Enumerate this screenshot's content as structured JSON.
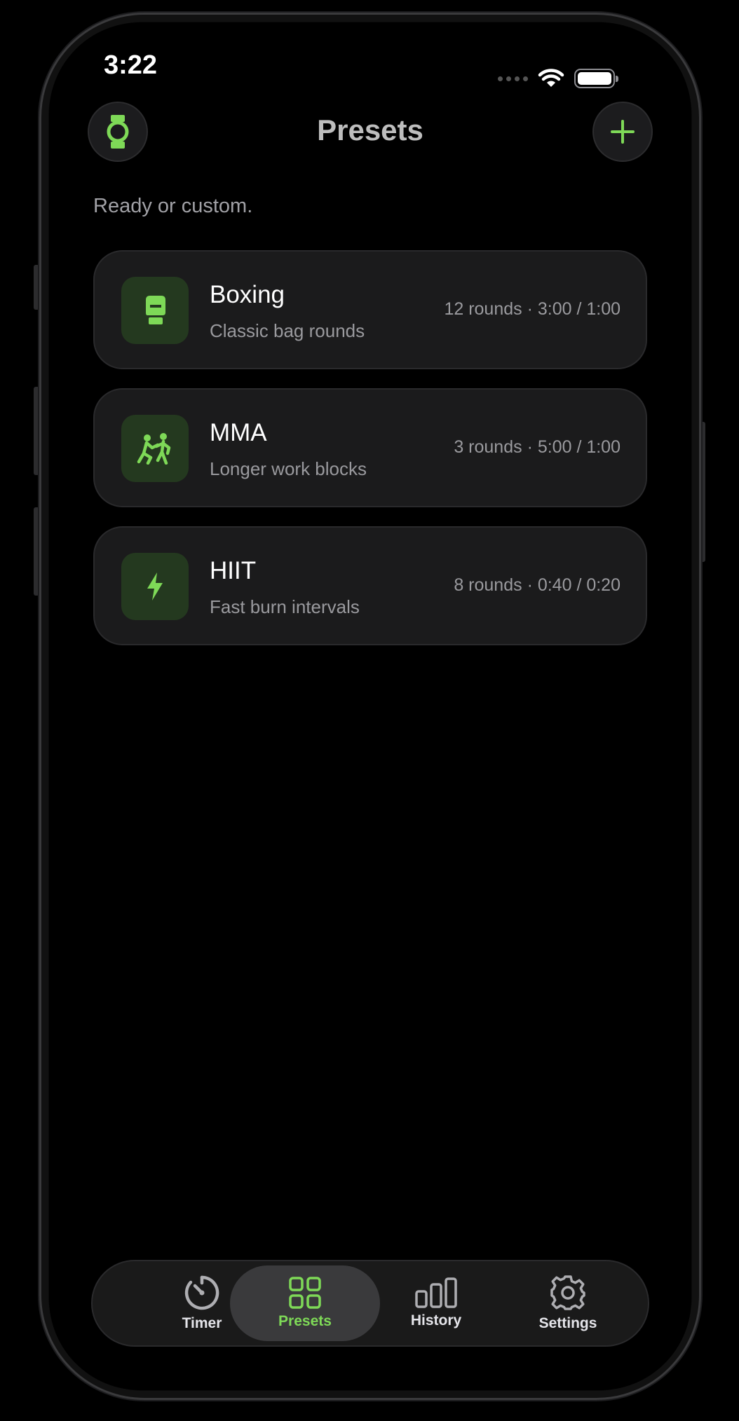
{
  "status_bar": {
    "time": "3:22"
  },
  "header": {
    "title": "Presets",
    "left_button_icon": "watch-icon",
    "right_button_icon": "plus-icon"
  },
  "subtitle": "Ready or custom.",
  "presets": [
    {
      "name": "Boxing",
      "description": "Classic bag rounds",
      "meta": "12 rounds · 3:00 / 1:00",
      "icon": "boxing-glove-icon"
    },
    {
      "name": "MMA",
      "description": "Longer work blocks",
      "meta": "3 rounds · 5:00 / 1:00",
      "icon": "sparring-icon"
    },
    {
      "name": "HIIT",
      "description": "Fast burn intervals",
      "meta": "8 rounds · 0:40 / 0:20",
      "icon": "lightning-icon"
    }
  ],
  "tabs": [
    {
      "label": "Timer",
      "icon": "timer-icon",
      "active": false
    },
    {
      "label": "Presets",
      "icon": "grid-icon",
      "active": true
    },
    {
      "label": "History",
      "icon": "bar-chart-icon",
      "active": false
    },
    {
      "label": "Settings",
      "icon": "gear-icon",
      "active": false
    }
  ],
  "colors": {
    "accent": "#7ed957",
    "background": "#000000",
    "card": "#1b1b1c",
    "icon_tile": "#24391f"
  }
}
